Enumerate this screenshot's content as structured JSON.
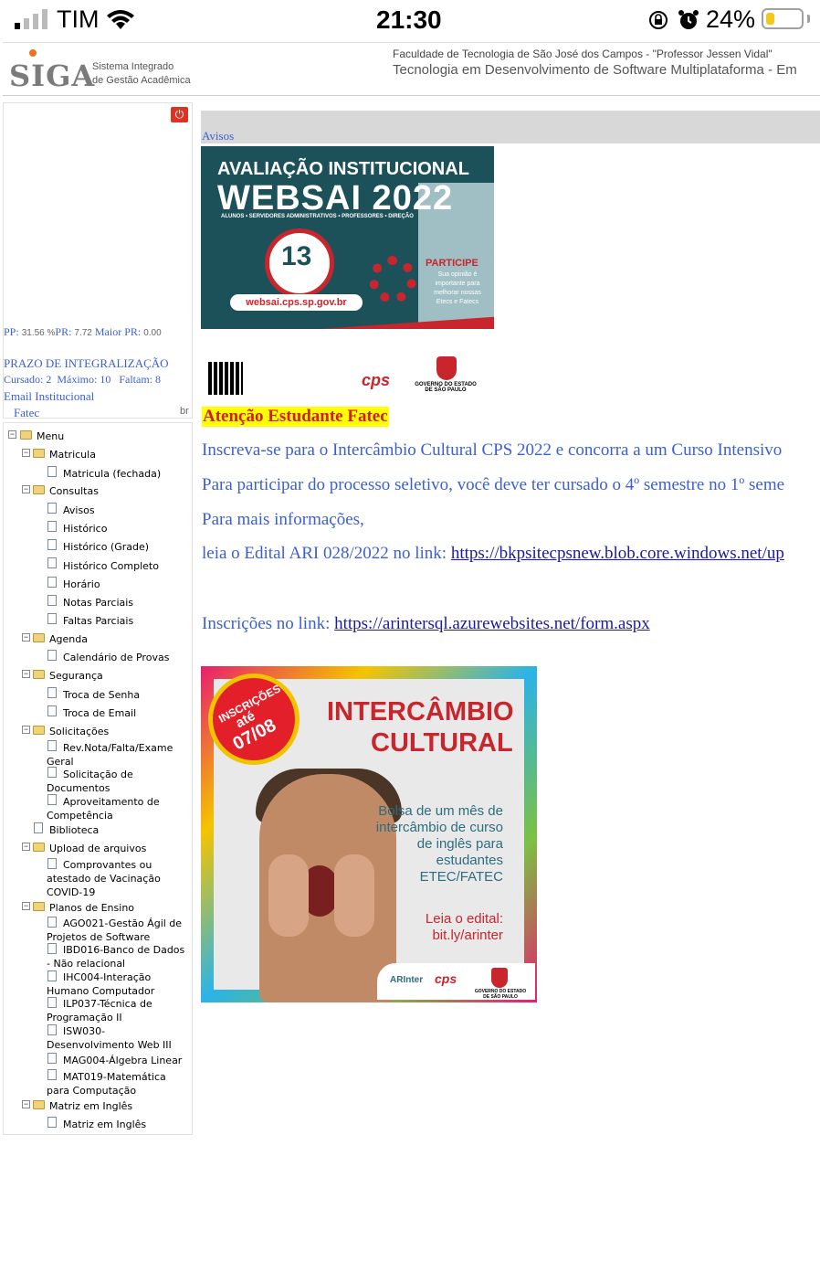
{
  "status_bar": {
    "carrier": "TIM",
    "time": "21:30",
    "battery_pct": "24%",
    "battery_level": 0.24
  },
  "header": {
    "logo_text": "SIGA",
    "logo_sub_1": "Sistema Integrado",
    "logo_sub_2": "de Gestão Acadêmica",
    "institution": "Faculdade de Tecnologia de São José dos Campos - \"Professor Jessen Vidal\"",
    "course": "Tecnologia em Desenvolvimento de Software Multiplataforma  -  Em"
  },
  "student_panel": {
    "pp_label": "PP:",
    "pp_value": "31.56 %",
    "pr_label": "PR:",
    "pr_value": "7.72",
    "maior_pr_label": "Maior PR:",
    "maior_pr_value": "0.00",
    "prazo_title": "PRAZO DE INTEGRALIZAÇÃO",
    "cursado_label": "Cursado:",
    "cursado_value": "2",
    "maximo_label": "Máximo:",
    "maximo_value": "10",
    "faltam_label": "Faltam:",
    "faltam_value": "8",
    "email_label": "Email Institucional",
    "email_user": "Fatec",
    "email_domain": "br"
  },
  "menu": {
    "root": "Menu",
    "matricula": "Matricula",
    "matricula_fechada": "Matricula (fechada)",
    "consultas": "Consultas",
    "avisos": "Avisos",
    "historico": "Histórico",
    "historico_grade": "Histórico (Grade)",
    "historico_completo": "Histórico Completo",
    "horario": "Horário",
    "notas_parciais": "Notas Parciais",
    "faltas_parciais": "Faltas Parciais",
    "agenda": "Agenda",
    "calendario": "Calendário de Provas",
    "seguranca": "Segurança",
    "troca_senha": "Troca de Senha",
    "troca_email": "Troca de Email",
    "solicitacoes": "Solicitações",
    "rev_nota_1": "Rev.Nota/Falta/Exame",
    "rev_nota_2": "Geral",
    "sol_doc_1": "Solicitação de",
    "sol_doc_2": "Documentos",
    "aprov_1": "Aproveitamento de",
    "aprov_2": "Competência",
    "biblioteca": "Biblioteca",
    "upload": "Upload de arquivos",
    "comprov_1": "Comprovantes ou",
    "comprov_2": "atestado de Vacinação",
    "comprov_3": "COVID-19",
    "planos": "Planos de Ensino",
    "ago021_1": "AGO021-Gestão Ágil de",
    "ago021_2": "Projetos de Software",
    "ibd016_1": "IBD016-Banco de Dados",
    "ibd016_2": "- Não relacional",
    "ihc004_1": "IHC004-Interação",
    "ihc004_2": "Humano Computador",
    "ilp037_1": "ILP037-Técnica de",
    "ilp037_2": "Programação II",
    "isw030_1": "ISW030-",
    "isw030_2": "Desenvolvimento Web III",
    "mag004": "MAG004-Álgebra Linear",
    "mat019_1": "MAT019-Matemática",
    "mat019_2": "para Computação",
    "matriz_ingles": "Matriz em Inglês",
    "matriz_ingles_item": "Matriz em Inglês"
  },
  "content": {
    "section_link": "Avisos",
    "banner1": {
      "line1": "AVALIAÇÃO INSTITUCIONAL",
      "line2": "WEBSAI 2022",
      "line3": "ALUNOS • SERVIDORES ADMINISTRATIVOS • PROFESSORES • DIREÇÃO",
      "badge_number": "13",
      "url": "websai.cps.sp.gov.br",
      "participe": "PARTICIPE",
      "participe_text": "Sua opinião é importante para melhorar nossas Etecs e Fatecs",
      "cps": "cps",
      "gov": "GOVERNO DO ESTADO DE SÃO PAULO"
    },
    "attention": "Atenção Estudante Fatec",
    "p1": "Inscreva-se para o Intercâmbio Cultural CPS 2022 e concorra a um Curso Intensivo",
    "p2": "Para participar do processo seletivo, você deve ter cursado o 4º semestre no 1º seme",
    "p3": "Para mais informações,",
    "p4_prefix": "leia o Edital ARI 028/2022 no link: ",
    "p4_link": "https://bkpsitecpsnew.blob.core.windows.net/up",
    "p5_prefix": "Inscrições no link: ",
    "p5_link": "https://arintersql.azurewebsites.net/form.aspx",
    "banner2": {
      "inscricoes": "INSCRIÇÕES",
      "ate": "até",
      "date": "07/08",
      "title1": "INTERCÂMBIO",
      "title2": "CULTURAL",
      "text": "Bolsa de um mês de intercâmbio de curso de inglês para estudantes ETEC/FATEC",
      "leia": "Leia o edital: bit.ly/arinter",
      "arinter": "ARInter",
      "cps": "cps",
      "gov": "GOVERNO DO ESTADO DE SÃO PAULO"
    }
  }
}
